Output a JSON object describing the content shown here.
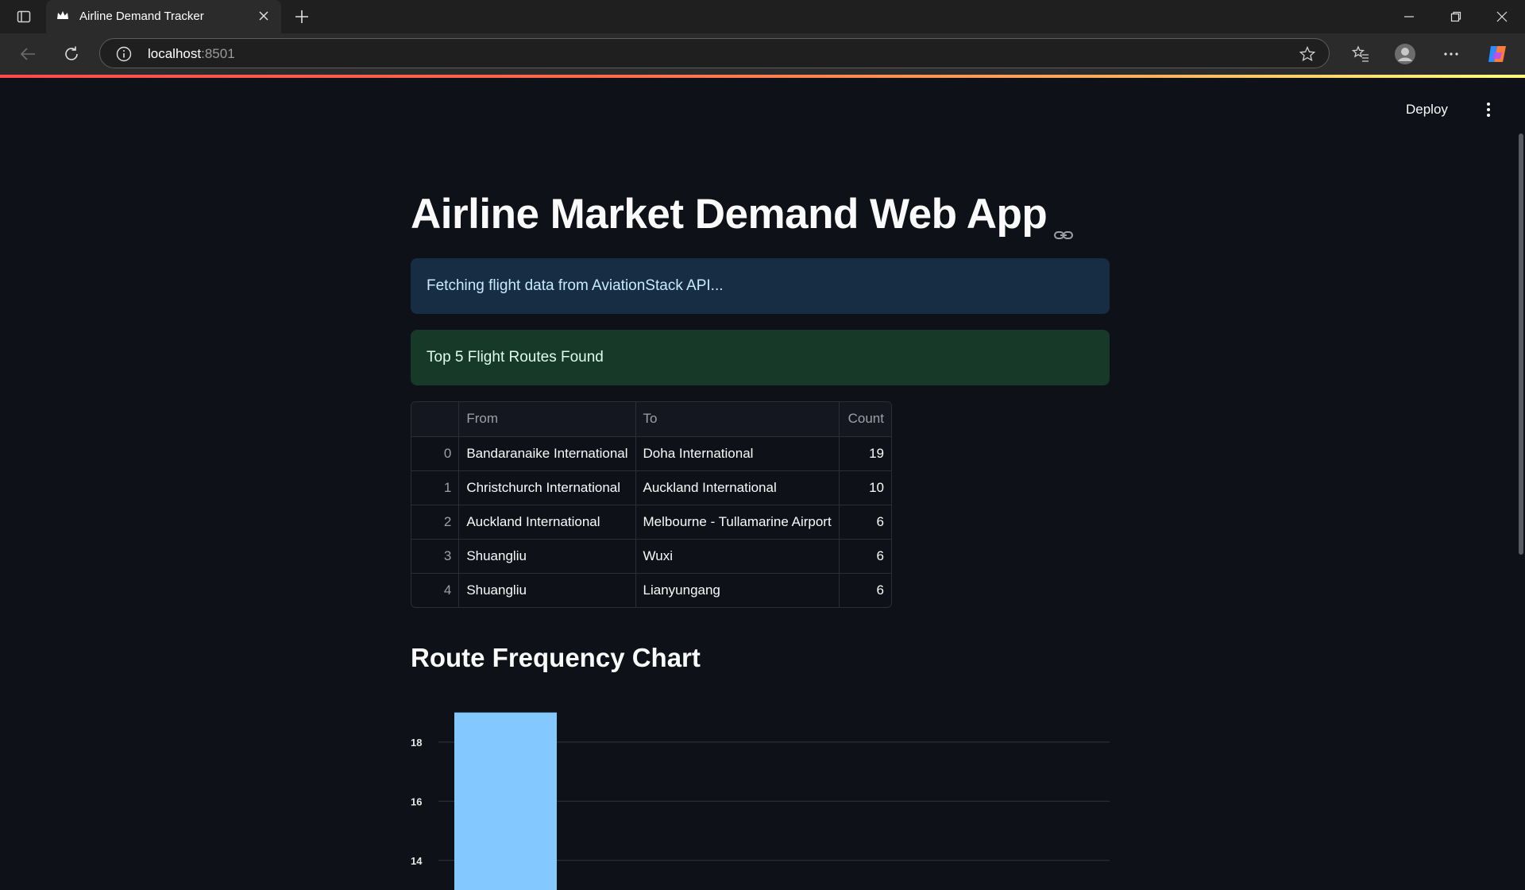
{
  "browser": {
    "tab_title": "Airline Demand Tracker",
    "url_host": "localhost",
    "url_port": ":8501"
  },
  "app": {
    "deploy_label": "Deploy",
    "title": "Airline Market Demand Web App",
    "info_message": "Fetching flight data from AviationStack API...",
    "success_message": "Top 5 Flight Routes Found",
    "table": {
      "columns": [
        "",
        "From",
        "To",
        "Count"
      ],
      "rows": [
        {
          "index": "0",
          "from": "Bandaranaike International",
          "to": "Doha International",
          "count": "19"
        },
        {
          "index": "1",
          "from": "Christchurch International",
          "to": "Auckland International",
          "count": "10"
        },
        {
          "index": "2",
          "from": "Auckland International",
          "to": "Melbourne - Tullamarine Airport",
          "count": "6"
        },
        {
          "index": "3",
          "from": "Shuangliu",
          "to": "Wuxi",
          "count": "6"
        },
        {
          "index": "4",
          "from": "Shuangliu",
          "to": "Lianyungang",
          "count": "6"
        }
      ]
    },
    "chart_heading": "Route Frequency Chart"
  },
  "colors": {
    "background": "#0e1117",
    "info_bg": "#172d43",
    "success_bg": "#173928",
    "bar": "#83c9ff",
    "gridline": "#31333f"
  },
  "chart_data": {
    "type": "bar",
    "categories": [],
    "values": [
      19
    ],
    "yticks": [
      14,
      16,
      18
    ],
    "ylim_visible": [
      13,
      19.5
    ],
    "title": "",
    "xlabel": "",
    "ylabel": "",
    "grid": true
  }
}
